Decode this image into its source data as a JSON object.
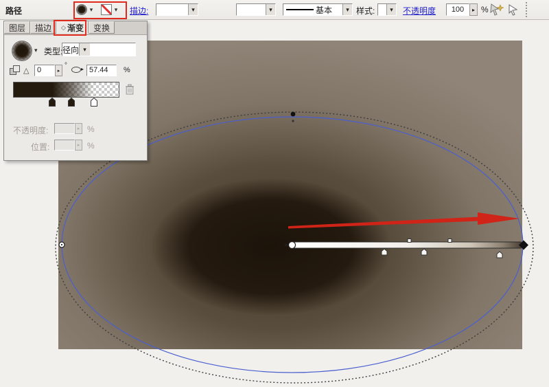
{
  "toolbar": {
    "path_label": "路径",
    "stroke_label": "描边:",
    "line_style_label": "基本",
    "style_label": "样式:",
    "opacity_label": "不透明度",
    "opacity_value": "100",
    "percent_symbol": "%"
  },
  "panel": {
    "tabs": [
      {
        "label": "图层",
        "active": false
      },
      {
        "label": "描边",
        "active": false
      },
      {
        "label": "渐变",
        "active": true
      },
      {
        "label": "变换",
        "active": false
      }
    ],
    "type_label": "类型:",
    "type_value": "径向",
    "angle_value": "0",
    "degree_symbol": "°",
    "ellipse_ratio_value": "57.44",
    "percent_symbol": "%",
    "opacity_label": "不透明度:",
    "position_label": "位置:",
    "gradient_stops": [
      {
        "position_pct": 37,
        "color": "#241a0e"
      },
      {
        "position_pct": 55,
        "color": "#241a0e"
      },
      {
        "position_pct": 76,
        "color": "#ffffff"
      }
    ]
  },
  "icons": {
    "dropdown_arrow": "▾",
    "stepper_arrow": "▸",
    "angle_triangle": "△",
    "tab_diamond": "◇",
    "ellipse_tip": "▸"
  },
  "colors": {
    "annotation_red": "#e02a1e",
    "path_outline_blue": "#4a5fd0",
    "link_blue": "#2323cc",
    "gradient_dark": "#241a0e",
    "canvas_base": "#8f8477"
  }
}
